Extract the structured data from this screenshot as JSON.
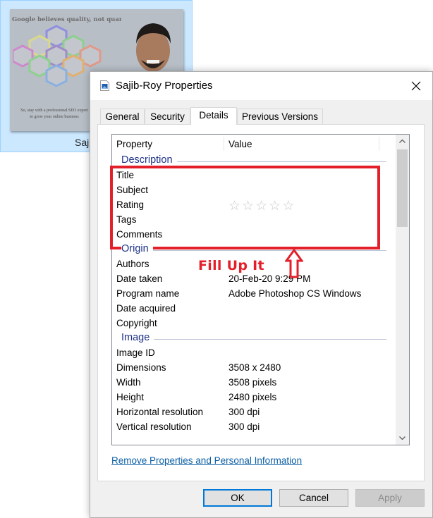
{
  "explorer": {
    "file_name_partial": "Saji",
    "thumbnail": {
      "headline": "Google believes quality, not quantity",
      "footer_line1": "So, stay with a professional SEO expert",
      "footer_line2": "to grow your online business"
    }
  },
  "dialog": {
    "title": "Sajib-Roy Properties",
    "title_icon": "image-file-icon",
    "close_icon": "close-icon",
    "tabs": [
      {
        "label": "General",
        "active": false
      },
      {
        "label": "Security",
        "active": false
      },
      {
        "label": "Details",
        "active": true
      },
      {
        "label": "Previous Versions",
        "active": false
      }
    ],
    "columns": {
      "property": "Property",
      "value": "Value"
    },
    "groups": [
      {
        "name": "Description",
        "rows": [
          {
            "property": "Title",
            "value": ""
          },
          {
            "property": "Subject",
            "value": ""
          },
          {
            "property": "Rating",
            "value": "",
            "rating_stars": 0,
            "rating_max": 5
          },
          {
            "property": "Tags",
            "value": ""
          },
          {
            "property": "Comments",
            "value": ""
          }
        ]
      },
      {
        "name": "Origin",
        "rows": [
          {
            "property": "Authors",
            "value": ""
          },
          {
            "property": "Date taken",
            "value": "20-Feb-20 9:29 PM"
          },
          {
            "property": "Program name",
            "value": "Adobe Photoshop CS Windows"
          },
          {
            "property": "Date acquired",
            "value": ""
          },
          {
            "property": "Copyright",
            "value": ""
          }
        ]
      },
      {
        "name": "Image",
        "rows": [
          {
            "property": "Image ID",
            "value": ""
          },
          {
            "property": "Dimensions",
            "value": "3508 x 2480"
          },
          {
            "property": "Width",
            "value": "3508 pixels"
          },
          {
            "property": "Height",
            "value": "2480 pixels"
          },
          {
            "property": "Horizontal resolution",
            "value": "300 dpi"
          },
          {
            "property": "Vertical resolution",
            "value": "300 dpi"
          }
        ]
      }
    ],
    "star_glyph": "☆",
    "remove_link": "Remove Properties and Personal Information",
    "buttons": {
      "ok": "OK",
      "cancel": "Cancel",
      "apply": "Apply"
    }
  },
  "annotation": {
    "text": "Fill Up It",
    "color": "#e3202a"
  }
}
